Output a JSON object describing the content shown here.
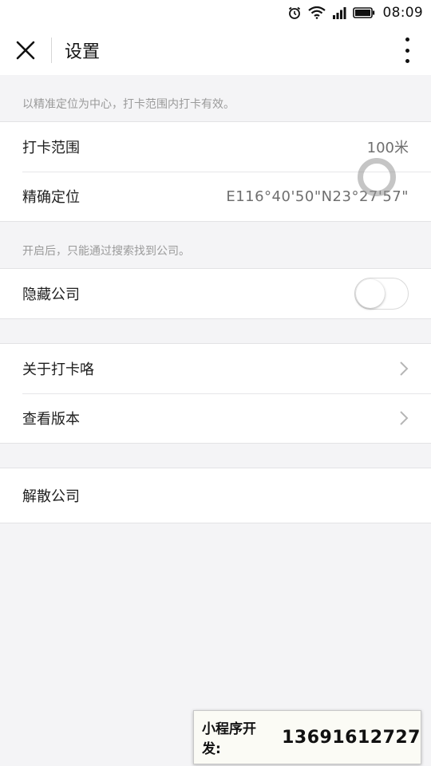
{
  "status_bar": {
    "time": "08:09",
    "icons": [
      "alarm-icon",
      "wifi-icon",
      "signal-icon",
      "battery-icon"
    ]
  },
  "nav": {
    "title": "设置",
    "close_icon": "close-icon",
    "more_icon": "more-vertical-icon"
  },
  "location_section": {
    "hint": "以精准定位为中心，打卡范围内打卡有效。",
    "rows": [
      {
        "label": "打卡范围",
        "value": "100米"
      },
      {
        "label": "精确定位",
        "value": "E116°40'50\"N23°27'57\""
      }
    ]
  },
  "visibility_section": {
    "hint": "开启后，只能通过搜索找到公司。",
    "toggle_label": "隐藏公司",
    "toggle_on": false
  },
  "info_section": {
    "items": [
      {
        "label": "关于打卡咯"
      },
      {
        "label": "查看版本"
      }
    ]
  },
  "danger_section": {
    "label": "解散公司"
  },
  "banner": {
    "label": "小程序开发:",
    "phone": "13691612727"
  },
  "colors": {
    "background": "#f4f4f6",
    "card": "#ffffff",
    "hint_text": "#9a9a9a",
    "divider": "#e3e3e5"
  }
}
